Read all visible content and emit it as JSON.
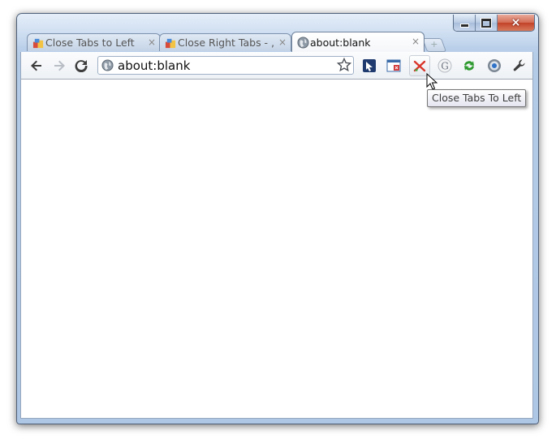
{
  "window": {
    "caption_buttons": {
      "minimize": "minimize",
      "maximize": "maximize",
      "close": "×"
    }
  },
  "tabs": [
    {
      "title": "Close Tabs to Left",
      "active": false,
      "icon": "extension-puzzle-icon"
    },
    {
      "title": "Close Right Tabs - ‚",
      "active": false,
      "icon": "extension-puzzle-icon"
    },
    {
      "title": "about:blank",
      "active": true,
      "icon": "globe-icon"
    }
  ],
  "tab_close_glyph": "×",
  "new_tab_glyph": "+",
  "toolbar": {
    "back": "back-arrow-icon",
    "forward": "forward-arrow-icon",
    "reload": "reload-icon",
    "omnibox": {
      "url": "about:blank",
      "icon": "globe-icon",
      "bookmark_icon": "star-icon"
    },
    "extensions": [
      "cursor-arrow-extension-icon",
      "window-tabs-extension-icon",
      "close-tabs-left-extension-icon",
      "google-extension-icon",
      "sync-recycle-extension-icon",
      "target-disc-extension-icon"
    ],
    "wrench": "wrench-icon"
  },
  "tooltip": {
    "text": "Close Tabs To Left"
  },
  "colors": {
    "frame": "#b4cbe7",
    "close_button": "#c24228",
    "tooltip_border": "#767676"
  }
}
